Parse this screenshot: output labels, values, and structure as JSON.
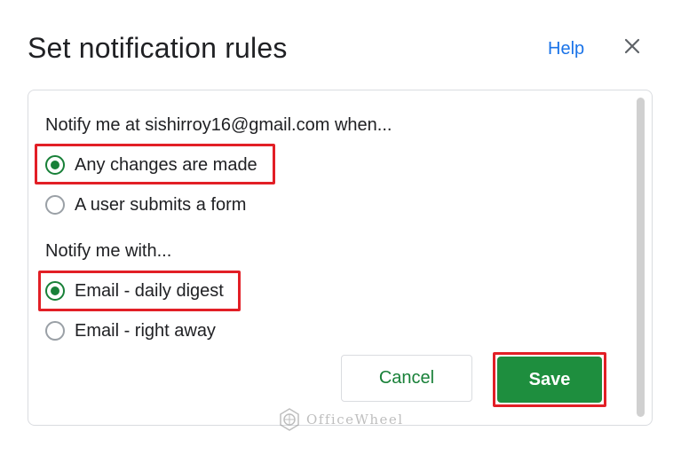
{
  "dialog": {
    "title": "Set notification rules",
    "help_label": "Help",
    "close_icon": "close-icon"
  },
  "when_section": {
    "label": "Notify me at sishirroy16@gmail.com when...",
    "options": [
      {
        "label": "Any changes are made",
        "checked": true,
        "highlighted": true
      },
      {
        "label": "A user submits a form",
        "checked": false,
        "highlighted": false
      }
    ]
  },
  "with_section": {
    "label": "Notify me with...",
    "options": [
      {
        "label": "Email - daily digest",
        "checked": true,
        "highlighted": true
      },
      {
        "label": "Email - right away",
        "checked": false,
        "highlighted": false
      }
    ]
  },
  "buttons": {
    "cancel_label": "Cancel",
    "save_label": "Save"
  },
  "watermark": {
    "text": "OfficeWheel"
  },
  "colors": {
    "accent_green": "#188038",
    "save_green": "#1e8e3e",
    "link_blue": "#1a73e8",
    "highlight_red": "#e21f26"
  }
}
